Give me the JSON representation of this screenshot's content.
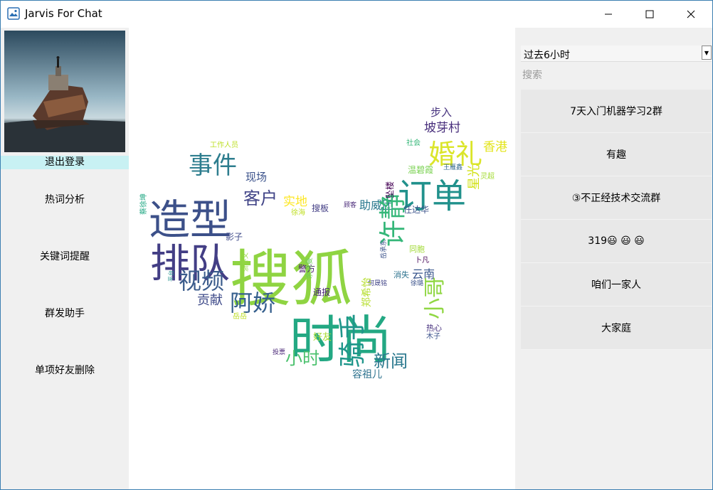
{
  "window": {
    "title": "Jarvis For Chat"
  },
  "sidebar": {
    "logout_label": "退出登录",
    "items": [
      {
        "label": "热词分析"
      },
      {
        "label": "关键词提醒"
      },
      {
        "label": "群发助手"
      },
      {
        "label": "单项好友删除"
      }
    ]
  },
  "right": {
    "time_range": "过去6小时",
    "search_placeholder": "搜索",
    "groups": [
      {
        "label": "7天入门机器学习2群"
      },
      {
        "label": "有趣"
      },
      {
        "label": "③不正经技术交流群"
      },
      {
        "label": "319😃 😃 😃"
      },
      {
        "label": "咱们一家人"
      },
      {
        "label": "大家庭"
      }
    ]
  },
  "wordcloud": {
    "words": [
      {
        "text": "搜狐",
        "color": "#8fd442"
      },
      {
        "text": "时尚",
        "color": "#23a883"
      },
      {
        "text": "造型",
        "color": "#3c5089"
      },
      {
        "text": "排队",
        "color": "#433e85"
      },
      {
        "text": "订单",
        "color": "#21918c"
      },
      {
        "text": "婚礼",
        "color": "#dbe52a"
      },
      {
        "text": "事件",
        "color": "#2d7d8e"
      },
      {
        "text": "视频",
        "color": "#3b5c8c"
      },
      {
        "text": "阿娇",
        "color": "#355f8d"
      },
      {
        "text": "许静",
        "color": "#35b779"
      },
      {
        "text": "骑手",
        "color": "#1f968b"
      },
      {
        "text": "小哥",
        "color": "#90d743"
      },
      {
        "text": "客户",
        "color": "#414487"
      },
      {
        "text": "新闻",
        "color": "#2a788e"
      },
      {
        "text": "小时",
        "color": "#4ac16d"
      },
      {
        "text": "坡芽村",
        "color": "#472d7b"
      },
      {
        "text": "香港",
        "color": "#e3e418"
      },
      {
        "text": "步入",
        "color": "#46327e"
      },
      {
        "text": "现场",
        "color": "#3b528b"
      },
      {
        "text": "实地",
        "color": "#fde725"
      },
      {
        "text": "助威团",
        "color": "#2a788e"
      },
      {
        "text": "贡献",
        "color": "#3e4a89"
      },
      {
        "text": "云南",
        "color": "#39568c"
      },
      {
        "text": "星光",
        "color": "#d2e21b"
      },
      {
        "text": "容祖儿",
        "color": "#2c728e"
      },
      {
        "text": "好友",
        "color": "#a8db34"
      },
      {
        "text": "通报",
        "color": "#482475"
      },
      {
        "text": "警方",
        "color": "#481a6c"
      },
      {
        "text": "温碧霞",
        "color": "#7ad151"
      },
      {
        "text": "任达华",
        "color": "#3b528b"
      },
      {
        "text": "搜板",
        "color": "#433e85"
      },
      {
        "text": "影子",
        "color": "#3e4a89"
      },
      {
        "text": "同胞",
        "color": "#a2da37"
      },
      {
        "text": "热心",
        "color": "#46307e"
      },
      {
        "text": "坠楼",
        "color": "#440154"
      },
      {
        "text": "郑希怡",
        "color": "#b5de2b"
      },
      {
        "text": "岳岳",
        "color": "#bddf26"
      },
      {
        "text": "徐海",
        "color": "#c0df25"
      },
      {
        "text": "木子",
        "color": "#3b528b"
      },
      {
        "text": "工作人员",
        "color": "#bddf26"
      },
      {
        "text": "蔡徐坤",
        "color": "#22a884"
      },
      {
        "text": "社会",
        "color": "#35b779"
      },
      {
        "text": "王雁鑫",
        "color": "#31688e"
      },
      {
        "text": "灵超",
        "color": "#a5db36"
      },
      {
        "text": "顾客",
        "color": "#482878"
      },
      {
        "text": "岳承东",
        "color": "#3b528b"
      },
      {
        "text": "余诗曼",
        "color": "#6ece58"
      },
      {
        "text": "卜凡",
        "color": "#440154"
      },
      {
        "text": "消失",
        "color": "#2c728e"
      },
      {
        "text": "徐璐",
        "color": "#3b528b"
      },
      {
        "text": "何晟铭",
        "color": "#414487"
      },
      {
        "text": "平台",
        "color": "#21918c"
      },
      {
        "text": "浙外义",
        "color": "#95d840"
      },
      {
        "text": "投票",
        "color": "#482576"
      }
    ]
  }
}
